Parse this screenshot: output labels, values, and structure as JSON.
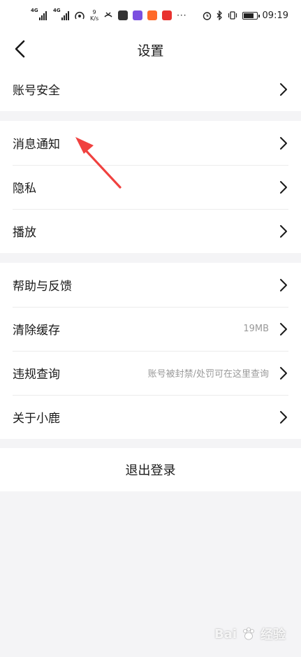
{
  "status_bar": {
    "network_1": "4G",
    "network_2": "4G",
    "speed_value": "9",
    "speed_unit": "K/s",
    "time": "09:19"
  },
  "header": {
    "title": "设置"
  },
  "settings": {
    "group_1": [
      {
        "label": "账号安全",
        "value": ""
      }
    ],
    "group_2": [
      {
        "label": "消息通知",
        "value": ""
      },
      {
        "label": "隐私",
        "value": ""
      },
      {
        "label": "播放",
        "value": ""
      }
    ],
    "group_3": [
      {
        "label": "帮助与反馈",
        "value": ""
      },
      {
        "label": "清除缓存",
        "value": "19MB"
      },
      {
        "label": "违规查询",
        "value": "账号被封禁/处罚可在这里查询"
      },
      {
        "label": "关于小鹿",
        "value": ""
      }
    ]
  },
  "logout": {
    "label": "退出登录"
  },
  "watermark": {
    "brand": "Bai",
    "suffix": "经验"
  },
  "colors": {
    "page_background": "#f4f4f6",
    "card_background": "#ffffff",
    "annotation_arrow": "#f0413f",
    "secondary_text": "#9a9a9a"
  }
}
